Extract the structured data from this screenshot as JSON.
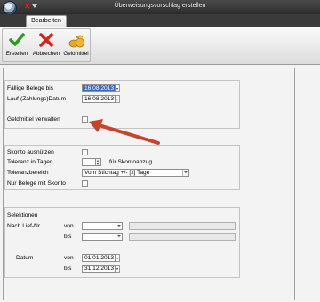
{
  "window": {
    "title": "Überweisungsvorschlag erstellen"
  },
  "ribbon": {
    "tab": "Bearbeiten",
    "buttons": {
      "create": "Erstellen",
      "cancel": "Abbrechen",
      "funds": "Geldmittel"
    }
  },
  "section1": {
    "due_docs_label": "Fällige Belege bis",
    "due_docs_value": "16.08.2013",
    "run_date_label": "Lauf-(Zahlungs)Datum",
    "run_date_value": "16.08.2013",
    "manage_funds_label": "Geldmittel verwalten",
    "manage_funds_checked": false
  },
  "section2": {
    "use_discount_label": "Skonto ausnützen",
    "tolerance_days_label": "Toleranz in Tagen",
    "tolerance_days_value": "",
    "for_discount_label": "für Skontoabzug",
    "tolerance_range_label": "Toleranzbereich",
    "tolerance_range_value": "Vom Stichtag +/- [x] Tage",
    "only_discount_label": "Nur Belege mit Skonto"
  },
  "selections": {
    "title": "Selektionen",
    "supplier_label": "Nach Lief-Nr.",
    "from_label": "von",
    "to_label": "bis",
    "date_label": "Datum",
    "date_from_label": "von",
    "date_from_value": "01.01.2013",
    "date_to_label": "bis",
    "date_to_value": "31.12.2013"
  },
  "colors": {
    "selection_blue": "#3a68c8",
    "annotation_arrow": "#c8432b"
  }
}
